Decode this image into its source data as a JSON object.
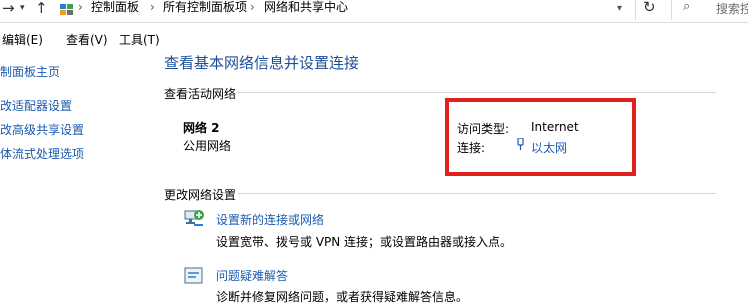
{
  "breadcrumb": {
    "items": [
      "控制面板",
      "所有控制面板项",
      "网络和共享中心"
    ]
  },
  "search": {
    "placeholder": "搜索控"
  },
  "menu": {
    "edit": "编辑(E)",
    "view": "查看(V)",
    "tools": "工具(T)"
  },
  "sidebar": {
    "items": [
      {
        "label": "制面板主页"
      },
      {
        "label": "改适配器设置"
      },
      {
        "label": "改高级共享设置"
      },
      {
        "label": "体流式处理选项"
      }
    ]
  },
  "main": {
    "title": "查看基本网络信息并设置连接",
    "active_section": "查看活动网络",
    "network": {
      "name": "网络 2",
      "category": "公用网络",
      "access_label": "访问类型:",
      "access_value": "Internet",
      "connection_label": "连接:",
      "connection_value": "以太网"
    },
    "change_section": "更改网络设置",
    "tasks": [
      {
        "link": "设置新的连接或网络",
        "desc": "设置宽带、拨号或 VPN 连接；或设置路由器或接入点。"
      },
      {
        "link": "问题疑难解答",
        "desc": "诊断并修复网络问题，或者获得疑难解答信息。"
      }
    ]
  },
  "colors": {
    "link": "#1a5bb0",
    "title": "#1e4e98",
    "highlight": "#e2211c"
  }
}
